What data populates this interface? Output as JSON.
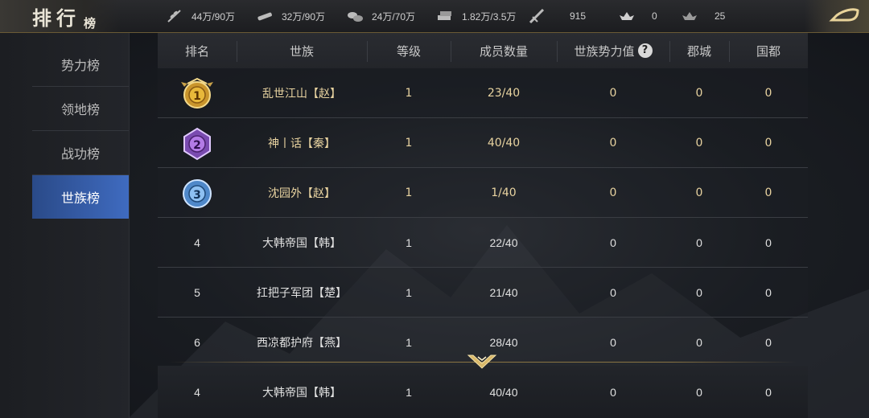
{
  "header": {
    "title_main": "排行",
    "title_sub": "榜"
  },
  "resources": [
    {
      "icon": "wheat-icon",
      "value": "44万/90万"
    },
    {
      "icon": "wood-icon",
      "value": "32万/90万"
    },
    {
      "icon": "stone-icon",
      "value": "24万/70万"
    },
    {
      "icon": "iron-icon",
      "value": "1.82万/3.5万"
    },
    {
      "icon": "order-icon",
      "value": "915"
    },
    {
      "icon": "gold-icon",
      "value": "0"
    },
    {
      "icon": "silver-icon",
      "value": "25"
    }
  ],
  "sidebar": {
    "items": [
      {
        "label": "势力榜"
      },
      {
        "label": "领地榜"
      },
      {
        "label": "战功榜"
      },
      {
        "label": "世族榜"
      }
    ],
    "active": "世族榜"
  },
  "table": {
    "headers": [
      "排名",
      "世族",
      "等级",
      "成员数量",
      "世族势力值",
      "郡城",
      "国都"
    ],
    "rows": [
      {
        "rank": "1",
        "name": "乱世江山【赵】",
        "level": "1",
        "members": "23/40",
        "power": "0",
        "commandery": "0",
        "capital": "0"
      },
      {
        "rank": "2",
        "name": "神丨话【秦】",
        "level": "1",
        "members": "40/40",
        "power": "0",
        "commandery": "0",
        "capital": "0"
      },
      {
        "rank": "3",
        "name": "沈园外【赵】",
        "level": "1",
        "members": "1/40",
        "power": "0",
        "commandery": "0",
        "capital": "0"
      },
      {
        "rank": "4",
        "name": "大韩帝国【韩】",
        "level": "1",
        "members": "22/40",
        "power": "0",
        "commandery": "0",
        "capital": "0"
      },
      {
        "rank": "5",
        "name": "扛把子军团【楚】",
        "level": "1",
        "members": "21/40",
        "power": "0",
        "commandery": "0",
        "capital": "0"
      },
      {
        "rank": "6",
        "name": "西凉都护府【燕】",
        "level": "1",
        "members": "28/40",
        "power": "0",
        "commandery": "0",
        "capital": "0"
      }
    ],
    "self_row": {
      "rank": "4",
      "name": "大韩帝国【韩】",
      "level": "1",
      "members": "40/40",
      "power": "0",
      "commandery": "0",
      "capital": "0"
    }
  },
  "colors": {
    "accent_gold": "#e8d3a0",
    "active_tab": "#3f6bc0"
  }
}
